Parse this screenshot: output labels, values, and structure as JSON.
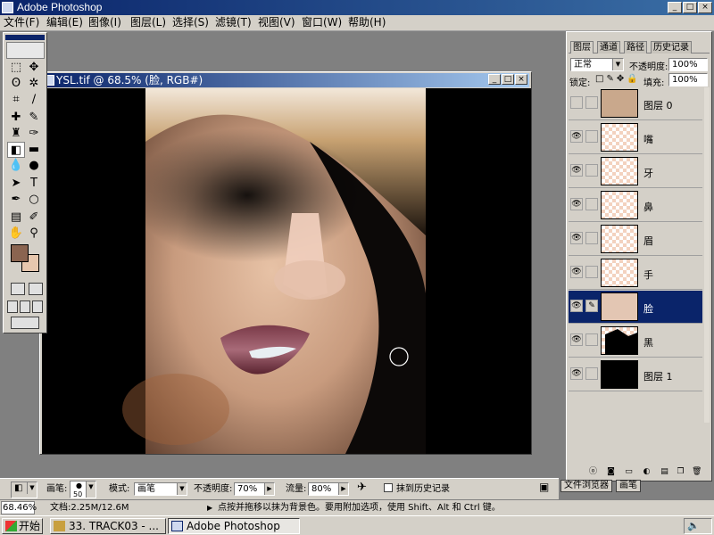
{
  "app": {
    "title": "Adobe Photoshop"
  },
  "menu": [
    {
      "label": "文件(F)"
    },
    {
      "label": "编辑(E)"
    },
    {
      "label": "图像(I)"
    },
    {
      "label": "图层(L)"
    },
    {
      "label": "选择(S)"
    },
    {
      "label": "滤镜(T)"
    },
    {
      "label": "视图(V)"
    },
    {
      "label": "窗口(W)"
    },
    {
      "label": "帮助(H)"
    }
  ],
  "document": {
    "title": "YSL.tif @ 68.5% (脸, RGB#)"
  },
  "layers_panel": {
    "tabs": [
      "图层",
      "通道",
      "路径",
      "历史记录"
    ],
    "blend_mode": "正常",
    "opacity_label": "不透明度:",
    "opacity_value": "100%",
    "lock_label": "锁定:",
    "fill_label": "填充:",
    "fill_value": "100%",
    "layers": [
      {
        "name": "图层 0",
        "visible": false
      },
      {
        "name": "嘴",
        "visible": true
      },
      {
        "name": "牙",
        "visible": true
      },
      {
        "name": "鼻",
        "visible": true
      },
      {
        "name": "眉",
        "visible": true
      },
      {
        "name": "手",
        "visible": true
      },
      {
        "name": "脸",
        "visible": true,
        "selected": true
      },
      {
        "name": "黑",
        "visible": true
      },
      {
        "name": "图层 1",
        "visible": true
      }
    ]
  },
  "dock": {
    "tabs": [
      "文件浏览器",
      "画笔"
    ]
  },
  "options_bar": {
    "brush_label": "画笔:",
    "brush_size": "50",
    "mode_label": "模式:",
    "mode_value": "画笔",
    "opacity_label": "不透明度:",
    "opacity_value": "70%",
    "flow_label": "流量:",
    "flow_value": "80%",
    "erase_history_label": "抹到历史记录"
  },
  "status_bar": {
    "zoom": "68.46%",
    "doc_size": "文档:2.25M/12.6M",
    "hint": "点按并拖移以抹为背景色。要用附加选项，使用 Shift、Alt 和 Ctrl 键。"
  },
  "taskbar": {
    "start_label": "开始",
    "tasks": [
      {
        "label": "33. TRACK03 - ..."
      },
      {
        "label": "Adobe Photoshop",
        "active": true
      }
    ]
  }
}
